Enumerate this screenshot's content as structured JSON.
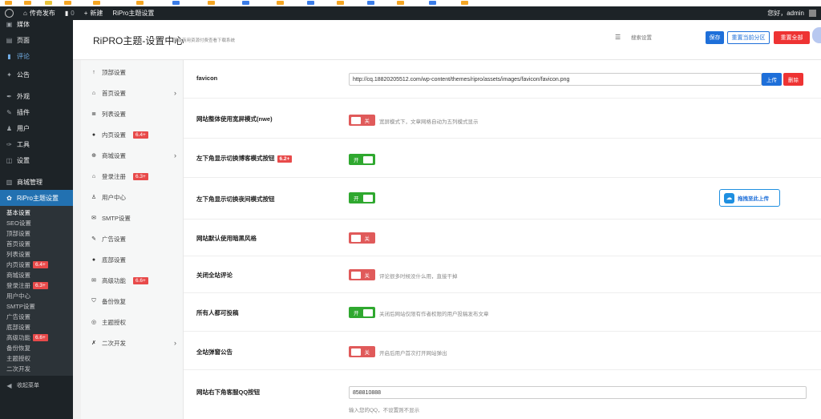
{
  "adminbar": {
    "site_name": "传奇发布",
    "comments_count": "0",
    "new_label": "新建",
    "theme_settings_label": "RiPro主题设置",
    "greeting": "您好，admin"
  },
  "wp_menu": {
    "media": "媒体",
    "pages": "页面",
    "comments": "评论",
    "announcements": "公告",
    "appearance": "外观",
    "plugins": "插件",
    "users": "用户",
    "tools": "工具",
    "settings": "设置",
    "shop": "商城管理",
    "ripro": "RiPro主题设置",
    "collapse": "收起菜单",
    "sub": [
      {
        "label": "基本设置"
      },
      {
        "label": "SEO设置"
      },
      {
        "label": "顶部设置"
      },
      {
        "label": "首页设置"
      },
      {
        "label": "列表设置"
      },
      {
        "label": "内页设置",
        "badge": "6.4+"
      },
      {
        "label": "商城设置"
      },
      {
        "label": "登录注册",
        "badge": "6.3+"
      },
      {
        "label": "用户中心"
      },
      {
        "label": "SMTP设置"
      },
      {
        "label": "广告设置"
      },
      {
        "label": "底部设置"
      },
      {
        "label": "高级功能",
        "badge": "6.6+"
      },
      {
        "label": "备份恢复"
      },
      {
        "label": "主题授权"
      },
      {
        "label": "二次开发"
      }
    ]
  },
  "header": {
    "title": "RiPRO主题-设置中心",
    "subtitle": "顶级商用资源付费查看下载系统",
    "search_placeholder": "搜索设置",
    "save": "保存",
    "reset_section": "重置当前分区",
    "reset_all": "重置全部"
  },
  "sections": [
    {
      "label": "顶部设置",
      "icon": "↑",
      "arrow": false
    },
    {
      "label": "首页设置",
      "icon": "⌂",
      "arrow": true
    },
    {
      "label": "列表设置",
      "icon": "≣",
      "arrow": false
    },
    {
      "label": "内页设置",
      "icon": "●",
      "arrow": false,
      "badge": "6.4+"
    },
    {
      "label": "商城设置",
      "icon": "⊕",
      "arrow": true
    },
    {
      "label": "登录注册",
      "icon": "⌂",
      "arrow": false,
      "badge": "6.3+"
    },
    {
      "label": "用户中心",
      "icon": "♙",
      "arrow": false
    },
    {
      "label": "SMTP设置",
      "icon": "✉",
      "arrow": false
    },
    {
      "label": "广告设置",
      "icon": "✎",
      "arrow": false
    },
    {
      "label": "底部设置",
      "icon": "●",
      "arrow": false
    },
    {
      "label": "高级功能",
      "icon": "✉",
      "arrow": false,
      "badge": "6.6+"
    },
    {
      "label": "备份恢复",
      "icon": "⛉",
      "arrow": false
    },
    {
      "label": "主题授权",
      "icon": "◎",
      "arrow": false
    },
    {
      "label": "二次开发",
      "icon": "✗",
      "arrow": true
    }
  ],
  "settings": {
    "favicon": {
      "label": "favicon",
      "value": "http://cq.18820205512.com/wp-content/themes/ripro/assets/images/favicon/favicon.png",
      "upload": "上传",
      "delete": "删除"
    },
    "wide_mode": {
      "label": "网站整体使用宽屏模式(nwe)",
      "state": "关",
      "hint": "宽屏模式下，文章网格自动为五列模式显示"
    },
    "blog_toggle": {
      "label": "左下角显示切换博客模式按钮",
      "badge": "6.2+",
      "state": "开"
    },
    "night_toggle": {
      "label": "左下角显示切换夜间模式按钮",
      "state": "开",
      "upload_pill": "拖拽至此上传"
    },
    "dark_default": {
      "label": "网站默认使用暗黑风格",
      "state": "关"
    },
    "close_comments": {
      "label": "关闭全站评论",
      "state": "关",
      "hint": "评论很多时候没什么用，直接干掉"
    },
    "all_can_post": {
      "label": "所有人都可投稿",
      "state": "开",
      "hint": "关闭后网站仅限有作者权限的用户投稿发布文章"
    },
    "popup_notice": {
      "label": "全站弹窗公告",
      "state": "关",
      "hint": "开启后用户首次打开网站弹出"
    },
    "qq_button": {
      "label": "网站右下角客服QQ按钮",
      "value": "858810888",
      "hint": "输入您的QQ，不设置则不显示"
    }
  },
  "colors": {
    "wp_dark": "#1d2327",
    "wp_blue": "#2271b1",
    "toggle_off": "#e05a5a",
    "toggle_on": "#2fa82f",
    "badge_red": "#e84a4a",
    "primary": "#1e6fd9"
  }
}
